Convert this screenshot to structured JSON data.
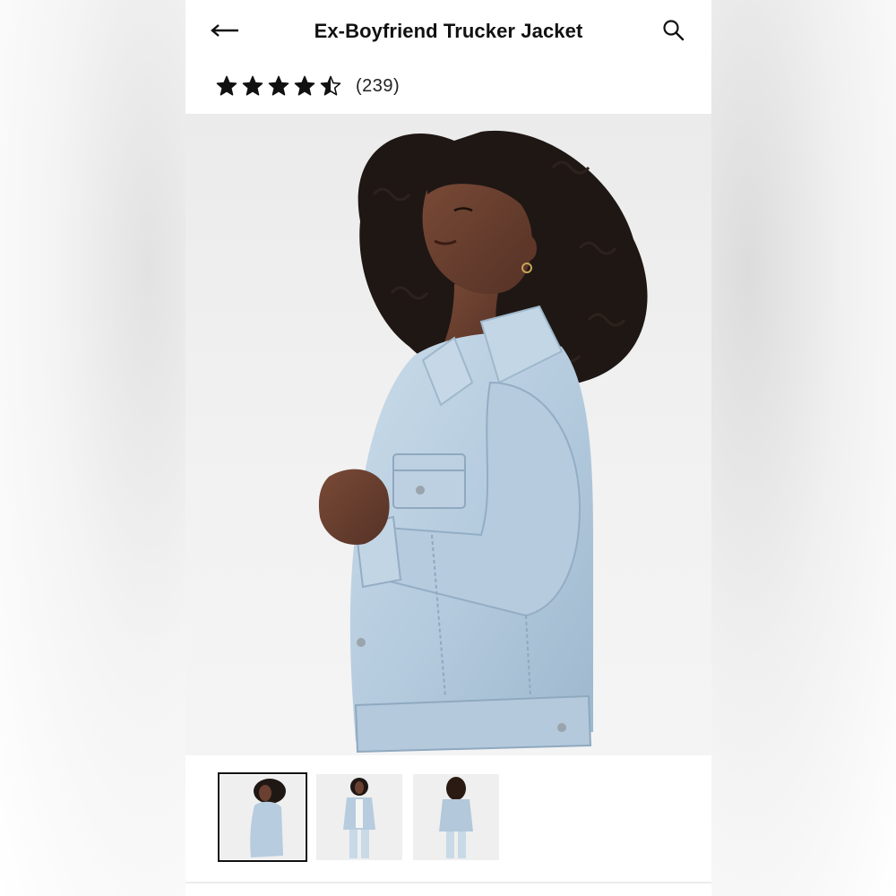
{
  "header": {
    "back_icon": "arrow-left-icon",
    "title": "Ex-Boyfriend Trucker Jacket",
    "search_icon": "search-icon"
  },
  "rating": {
    "value": 4.5,
    "max": 5,
    "review_count": "(239)"
  },
  "gallery": {
    "hero_image": "woman-in-light-denim-jacket-side-view",
    "thumbnails": [
      {
        "name": "thumbnail-side-view",
        "selected": true
      },
      {
        "name": "thumbnail-front-view",
        "selected": false
      },
      {
        "name": "thumbnail-back-view",
        "selected": false
      }
    ]
  },
  "colors": {
    "denim": "#b9cfe0",
    "denim_shadow": "#93adc4",
    "hair": "#1e1613",
    "skin": "#6b4030",
    "text": "#111111"
  }
}
